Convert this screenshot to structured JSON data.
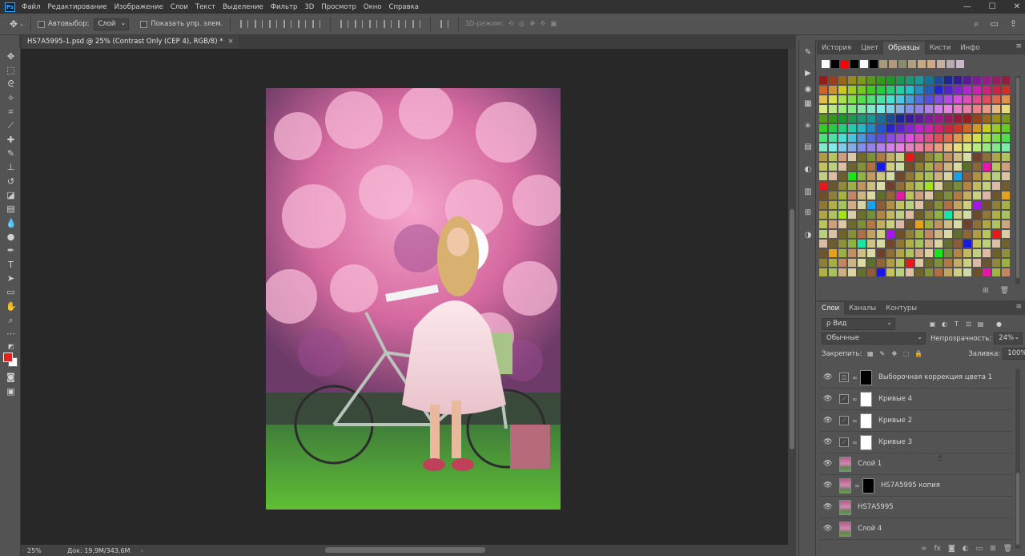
{
  "app": {
    "logo": "Ps"
  },
  "menu": [
    "Файл",
    "Редактирование",
    "Изображение",
    "Слои",
    "Текст",
    "Выделение",
    "Фильтр",
    "3D",
    "Просмотр",
    "Окно",
    "Справка"
  ],
  "window_controls": [
    "—",
    "☐",
    "✕"
  ],
  "options_bar": {
    "autoselect_label": "Автовыбор:",
    "autoselect_value": "Слой",
    "show_controls_label": "Показать упр. элем.",
    "mode_3d_label": "3D-режим:"
  },
  "document": {
    "tab_title": "HS7A5995-1.psd @ 25% (Contrast Only  (CEP 4), RGB/8) *",
    "close": "×"
  },
  "status": {
    "zoom": "25%",
    "doc_info": "Док: 19,9M/343,6M",
    "arrow": "›"
  },
  "swatches_panel": {
    "tabs": [
      "История",
      "Цвет",
      "Образцы",
      "Кисти",
      "Инфо"
    ],
    "active_tab": "Образцы",
    "recent": [
      "#ffffff",
      "#000000",
      "#ff0000",
      "#000000",
      "#ffffff",
      "#000000",
      "#a89a7a",
      "#b09878",
      "#8c8a6c",
      "#b0a080",
      "#c8a880",
      "#d0a888",
      "#c8b0a0",
      "#b8a8b0",
      "#c8b8c8"
    ]
  },
  "layers_panel": {
    "tabs": [
      "Слои",
      "Каналы",
      "Контуры"
    ],
    "active_tab": "Слои",
    "filter_label": "ρ Вид",
    "blend_mode": "Обычные",
    "opacity_label": "Непрозрачность:",
    "opacity_value": "24%",
    "lock_label": "Закрепить:",
    "fill_label": "Заливка:",
    "fill_value": "100%",
    "layers": [
      {
        "name": "Выборочная коррекция цвета 1",
        "kind": "adjustment",
        "mask": "black"
      },
      {
        "name": "Кривые 4",
        "kind": "curves",
        "mask": "white"
      },
      {
        "name": "Кривые 2",
        "kind": "curves",
        "mask": "white"
      },
      {
        "name": "Кривые 3",
        "kind": "curves",
        "mask": "white"
      },
      {
        "name": "Слой 1",
        "kind": "image",
        "mask": ""
      },
      {
        "name": "HS7A5995 копия",
        "kind": "image",
        "mask": "black"
      },
      {
        "name": "HS7A5995",
        "kind": "image",
        "mask": ""
      },
      {
        "name": "Слой 4",
        "kind": "image",
        "mask": ""
      }
    ]
  },
  "colors": {
    "foreground": "#ee1c1c",
    "background": "#ffffff",
    "accent": "#31a8ff"
  }
}
